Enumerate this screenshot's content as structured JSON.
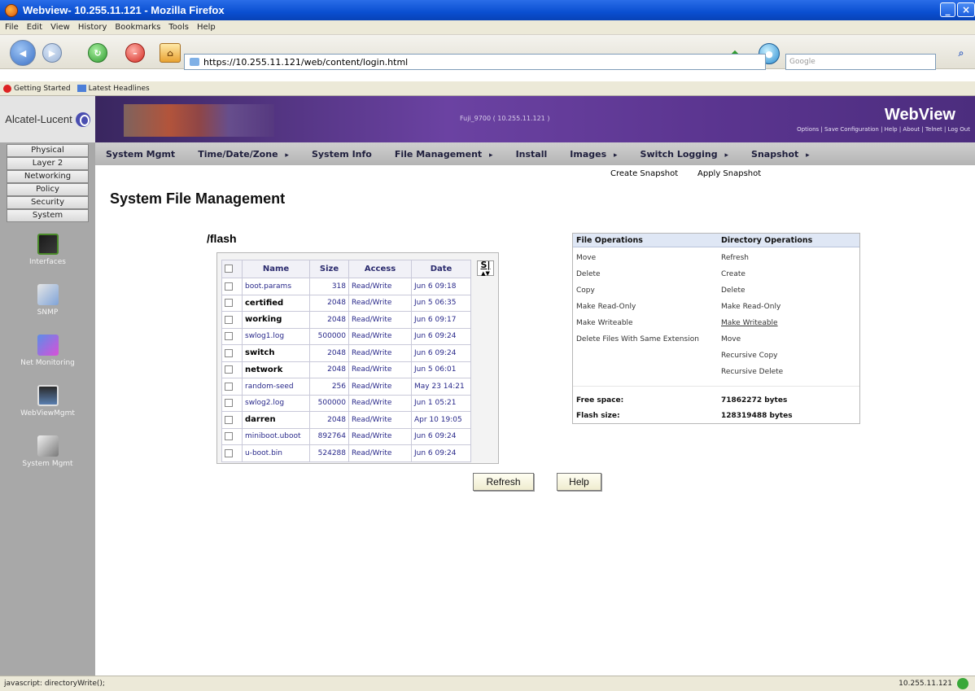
{
  "window": {
    "title": "Webview- 10.255.11.121 - Mozilla Firefox"
  },
  "menubar": [
    "File",
    "Edit",
    "View",
    "History",
    "Bookmarks",
    "Tools",
    "Help"
  ],
  "browser": {
    "url": "https://10.255.11.121/web/content/login.html",
    "search_placeholder": "Google"
  },
  "bookmarks": [
    "Getting Started",
    "Latest Headlines"
  ],
  "header": {
    "brand": "Alcatel-Lucent",
    "system_info": "Fuji_9700 ( 10.255.11.121 )",
    "app_title": "WebView",
    "links": "Options | Save Configuration | Help | About | Telnet | Log Out"
  },
  "leftnav": {
    "tabs": [
      "Physical",
      "Layer 2",
      "Networking",
      "Policy",
      "Security",
      "System"
    ],
    "items": [
      "Interfaces",
      "SNMP",
      "Net Monitoring",
      "WebViewMgmt",
      "System Mgmt"
    ]
  },
  "topnav": {
    "tabs": [
      "System Mgmt",
      "Time/Date/Zone",
      "System Info",
      "File Management",
      "Install",
      "Images",
      "Switch Logging",
      "Snapshot"
    ],
    "subtabs": [
      "Create Snapshot",
      "Apply Snapshot"
    ]
  },
  "page": {
    "title": "System File Management",
    "directory": "/flash"
  },
  "file_table": {
    "headers": [
      "Name",
      "Size",
      "Access",
      "Date"
    ],
    "sort_label": "S|",
    "sort_arrows": "▲▼",
    "rows": [
      {
        "name": "boot.params",
        "size": "318",
        "access": "Read/Write",
        "date": "Jun 6 09:18",
        "type": "file"
      },
      {
        "name": "certified",
        "size": "2048",
        "access": "Read/Write",
        "date": "Jun 5 06:35",
        "type": "dir"
      },
      {
        "name": "working",
        "size": "2048",
        "access": "Read/Write",
        "date": "Jun 6 09:17",
        "type": "dir"
      },
      {
        "name": "swlog1.log",
        "size": "500000",
        "access": "Read/Write",
        "date": "Jun 6 09:24",
        "type": "file"
      },
      {
        "name": "switch",
        "size": "2048",
        "access": "Read/Write",
        "date": "Jun 6 09:24",
        "type": "dir"
      },
      {
        "name": "network",
        "size": "2048",
        "access": "Read/Write",
        "date": "Jun 5 06:01",
        "type": "dir"
      },
      {
        "name": "random-seed",
        "size": "256",
        "access": "Read/Write",
        "date": "May 23 14:21",
        "type": "file"
      },
      {
        "name": "swlog2.log",
        "size": "500000",
        "access": "Read/Write",
        "date": "Jun 1 05:21",
        "type": "file"
      },
      {
        "name": "darren",
        "size": "2048",
        "access": "Read/Write",
        "date": "Apr 10 19:05",
        "type": "dir"
      },
      {
        "name": "miniboot.uboot",
        "size": "892764",
        "access": "Read/Write",
        "date": "Jun 6 09:24",
        "type": "file"
      },
      {
        "name": "u-boot.bin",
        "size": "524288",
        "access": "Read/Write",
        "date": "Jun 6 09:24",
        "type": "file"
      }
    ]
  },
  "operations": {
    "file_header": "File Operations",
    "dir_header": "Directory Operations",
    "file_ops": [
      "Move",
      "Delete",
      "Copy",
      "Make Read-Only",
      "Make Writeable",
      "Delete Files With Same Extension"
    ],
    "dir_ops": [
      "Refresh",
      "Create",
      "Delete",
      "Make Read-Only",
      "Make Writeable",
      "Move",
      "Recursive Copy",
      "Recursive Delete"
    ],
    "free_space_label": "Free space:",
    "free_space_value": "71862272 bytes",
    "flash_size_label": "Flash size:",
    "flash_size_value": "128319488 bytes"
  },
  "buttons": {
    "refresh": "Refresh",
    "help": "Help"
  },
  "status": {
    "text": "javascript: directoryWrite();",
    "host": "10.255.11.121"
  }
}
